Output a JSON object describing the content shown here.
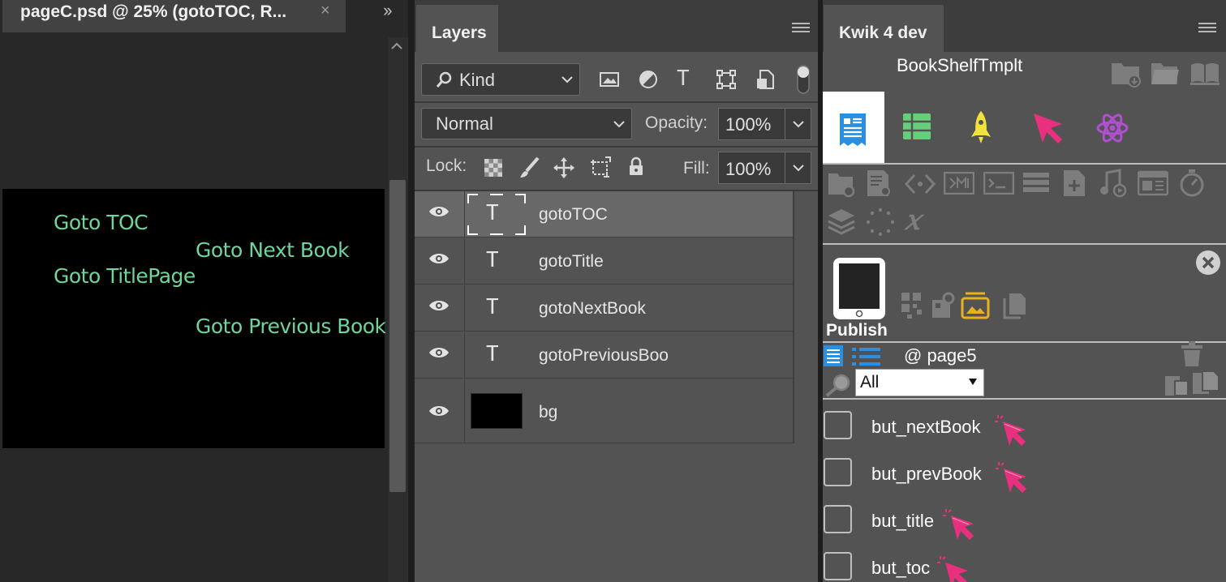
{
  "document": {
    "tab_title": "pageC.psd @ 25% (gotoTOC, R...",
    "close_glyph": "×",
    "collapse_glyph": "››",
    "canvas_texts": [
      "Goto TOC",
      "Goto Next Book",
      "Goto TitlePage",
      "Goto Previous Book"
    ],
    "text_color": "#6fd59b"
  },
  "layers": {
    "tab_label": "Layers",
    "filter": {
      "label": "Kind",
      "icon": "search-icon"
    },
    "blend_mode": "Normal",
    "opacity_label": "Opacity:",
    "opacity_value": "100%",
    "lock_label": "Lock:",
    "fill_label": "Fill:",
    "fill_value": "100%",
    "items": [
      {
        "name": "gotoTOC",
        "type": "text",
        "selected": true
      },
      {
        "name": "gotoTitle",
        "type": "text"
      },
      {
        "name": "gotoNextBook",
        "type": "text"
      },
      {
        "name": "gotoPreviousBoo",
        "type": "text"
      },
      {
        "name": "bg",
        "type": "raster"
      }
    ]
  },
  "kwik": {
    "tab_label": "Kwik 4 dev",
    "project_name": "BookShelfTmplt",
    "publish_label": "Publish",
    "page_label": "@ page5",
    "filter_value": "All",
    "buttons": [
      {
        "label": "but_nextBook"
      },
      {
        "label": "but_prevBook"
      },
      {
        "label": "but_title"
      },
      {
        "label": "but_toc"
      }
    ],
    "colors": {
      "accent_pink": "#e8307f",
      "accent_green": "#66cf7a",
      "accent_yellow": "#f2e33a",
      "accent_purple": "#b14fd1",
      "accent_blue": "#2a8fe0"
    }
  }
}
